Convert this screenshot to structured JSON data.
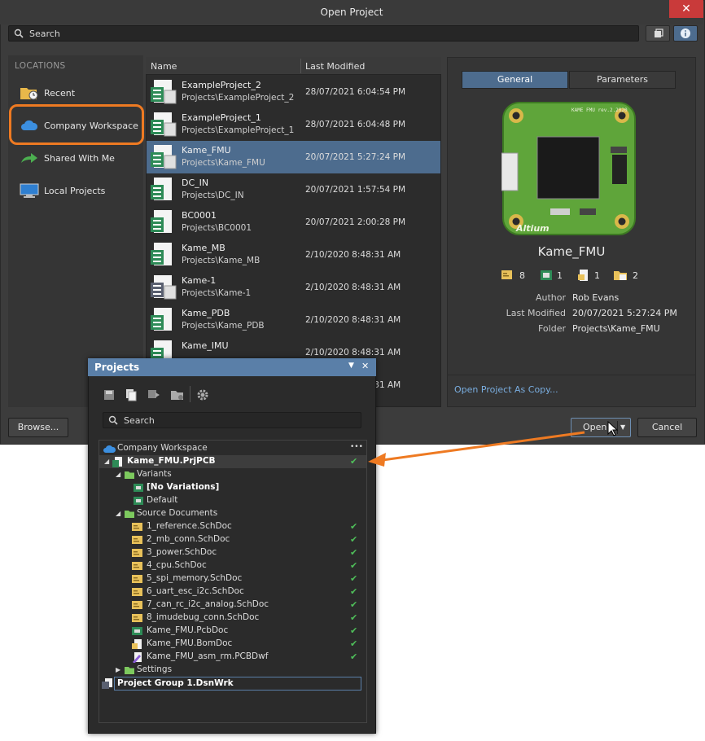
{
  "dialog": {
    "title": "Open Project",
    "close_label": "✕",
    "search_placeholder": "Search",
    "locations_header": "LOCATIONS",
    "locations": [
      {
        "label": "Recent",
        "icon": "folder-clock-icon"
      },
      {
        "label": "Company Workspace",
        "icon": "cloud-icon"
      },
      {
        "label": "Shared With Me",
        "icon": "share-arrow-icon"
      },
      {
        "label": "Local Projects",
        "icon": "monitor-icon"
      }
    ],
    "columns": {
      "name": "Name",
      "modified": "Last Modified"
    },
    "files": [
      {
        "name": "ExampleProject_2",
        "path": "Projects\\ExampleProject_2",
        "date": "28/07/2021 6:04:54 PM"
      },
      {
        "name": "ExampleProject_1",
        "path": "Projects\\ExampleProject_1",
        "date": "28/07/2021 6:04:48 PM"
      },
      {
        "name": "Kame_FMU",
        "path": "Projects\\Kame_FMU",
        "date": "20/07/2021 5:27:24 PM"
      },
      {
        "name": "DC_IN",
        "path": "Projects\\DC_IN",
        "date": "20/07/2021 1:57:54 PM"
      },
      {
        "name": "BC0001",
        "path": "Projects\\BC0001",
        "date": "20/07/2021 2:00:28 PM"
      },
      {
        "name": "Kame_MB",
        "path": "Projects\\Kame_MB",
        "date": "2/10/2020 8:48:31 AM"
      },
      {
        "name": "Kame-1",
        "path": "Projects\\Kame-1",
        "date": "2/10/2020 8:48:31 AM"
      },
      {
        "name": "Kame_PDB",
        "path": "Projects\\Kame_PDB",
        "date": "2/10/2020 8:48:31 AM"
      },
      {
        "name": "Kame_IMU",
        "path": "",
        "date": "2/10/2020 8:48:31 AM"
      },
      {
        "name": "",
        "path": "",
        "date": "2/10/2020 8:48:31 AM"
      }
    ],
    "details": {
      "tab_general": "General",
      "tab_parameters": "Parameters",
      "board_silk": "KAME FMU rev.2.2020",
      "board_brand": "Altium",
      "project_name": "Kame_FMU",
      "counts": [
        {
          "icon": "schematic-icon",
          "value": "8"
        },
        {
          "icon": "pcb-icon",
          "value": "1"
        },
        {
          "icon": "document-icon",
          "value": "1"
        },
        {
          "icon": "folder-icon",
          "value": "2"
        }
      ],
      "author_label": "Author",
      "author": "Rob Evans",
      "modified_label": "Last Modified",
      "modified": "20/07/2021 5:27:24 PM",
      "folder_label": "Folder",
      "folder": "Projects\\Kame_FMU",
      "open_copy": "Open Project As Copy..."
    },
    "browse_label": "Browse...",
    "open_label": "Open",
    "cancel_label": "Cancel"
  },
  "projects_panel": {
    "title": "Projects",
    "search_placeholder": "Search",
    "workspace_label": "Company Workspace",
    "more_label": "•••",
    "project": "Kame_FMU.PrjPCB",
    "variants_folder": "Variants",
    "variants": [
      "[No Variations]",
      "Default"
    ],
    "source_folder": "Source Documents",
    "documents": [
      "1_reference.SchDoc",
      "2_mb_conn.SchDoc",
      "3_power.SchDoc",
      "4_cpu.SchDoc",
      "5_spi_memory.SchDoc",
      "6_uart_esc_i2c.SchDoc",
      "7_can_rc_i2c_analog.SchDoc",
      "8_imudebug_conn.SchDoc",
      "Kame_FMU.PcbDoc",
      "Kame_FMU.BomDoc",
      "Kame_FMU_asm_rm.PCBDwf"
    ],
    "settings_folder": "Settings",
    "group": "Project Group 1.DsnWrk",
    "check_mark": "✔"
  },
  "colors": {
    "accent": "#4d6c8e",
    "highlight": "#ee7a22",
    "ok": "#4fbf5a",
    "panel_title": "#5a7fa8"
  }
}
